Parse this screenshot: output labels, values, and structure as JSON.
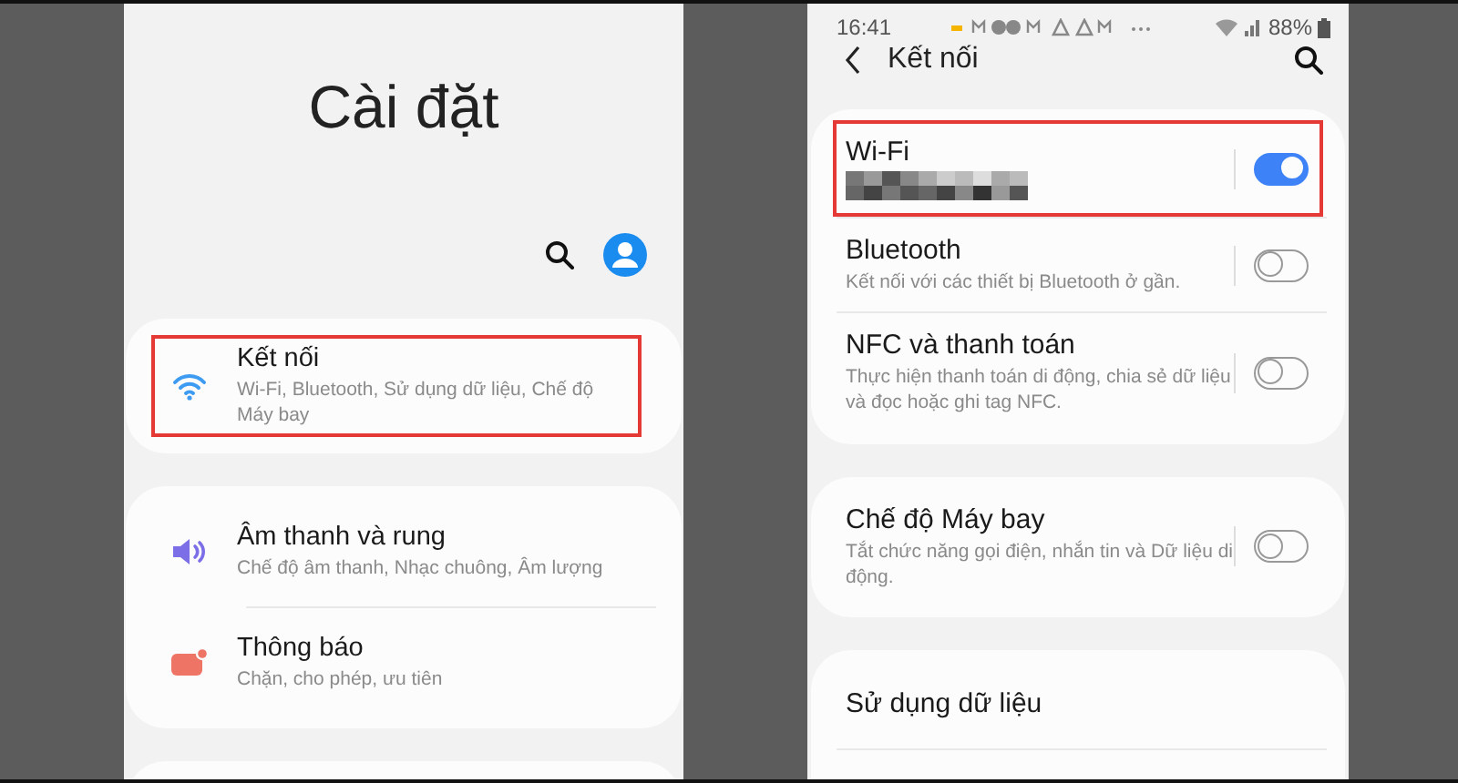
{
  "settings_screen": {
    "title": "Cài đặt",
    "groups": [
      {
        "items": [
          {
            "kind": "wifi",
            "title": "Kết nối",
            "subtitle": "Wi-Fi, Bluetooth, Sử dụng dữ liệu, Chế độ Máy bay",
            "highlighted": true
          }
        ]
      },
      {
        "items": [
          {
            "kind": "sound",
            "title": "Âm thanh và rung",
            "subtitle": "Chế độ âm thanh, Nhạc chuông, Âm lượng",
            "highlighted": false
          },
          {
            "kind": "notification",
            "title": "Thông báo",
            "subtitle": "Chặn, cho phép, ưu tiên",
            "highlighted": false
          }
        ]
      }
    ]
  },
  "connections_screen": {
    "status_bar": {
      "time": "16:41",
      "battery": "88%"
    },
    "header": {
      "title": "Kết nối"
    },
    "groups": [
      {
        "items": [
          {
            "kind": "toggle",
            "title": "Wi-Fi",
            "redacted": true,
            "on": true,
            "highlighted": true
          },
          {
            "kind": "toggle",
            "title": "Bluetooth",
            "subtitle": "Kết nối với các thiết bị Bluetooth ở gần.",
            "on": false,
            "highlighted": false
          },
          {
            "kind": "toggle",
            "title": "NFC và thanh toán",
            "subtitle": "Thực hiện thanh toán di động, chia sẻ dữ liệu và đọc hoặc ghi tag NFC.",
            "on": false,
            "highlighted": false
          }
        ]
      },
      {
        "items": [
          {
            "kind": "toggle",
            "title": "Chế độ Máy bay",
            "subtitle": "Tắt chức năng gọi điện, nhắn tin và Dữ liệu di động.",
            "on": false,
            "highlighted": false
          }
        ]
      },
      {
        "items": [
          {
            "kind": "link",
            "title": "Sử dụng dữ liệu",
            "highlighted": false
          }
        ]
      }
    ]
  }
}
